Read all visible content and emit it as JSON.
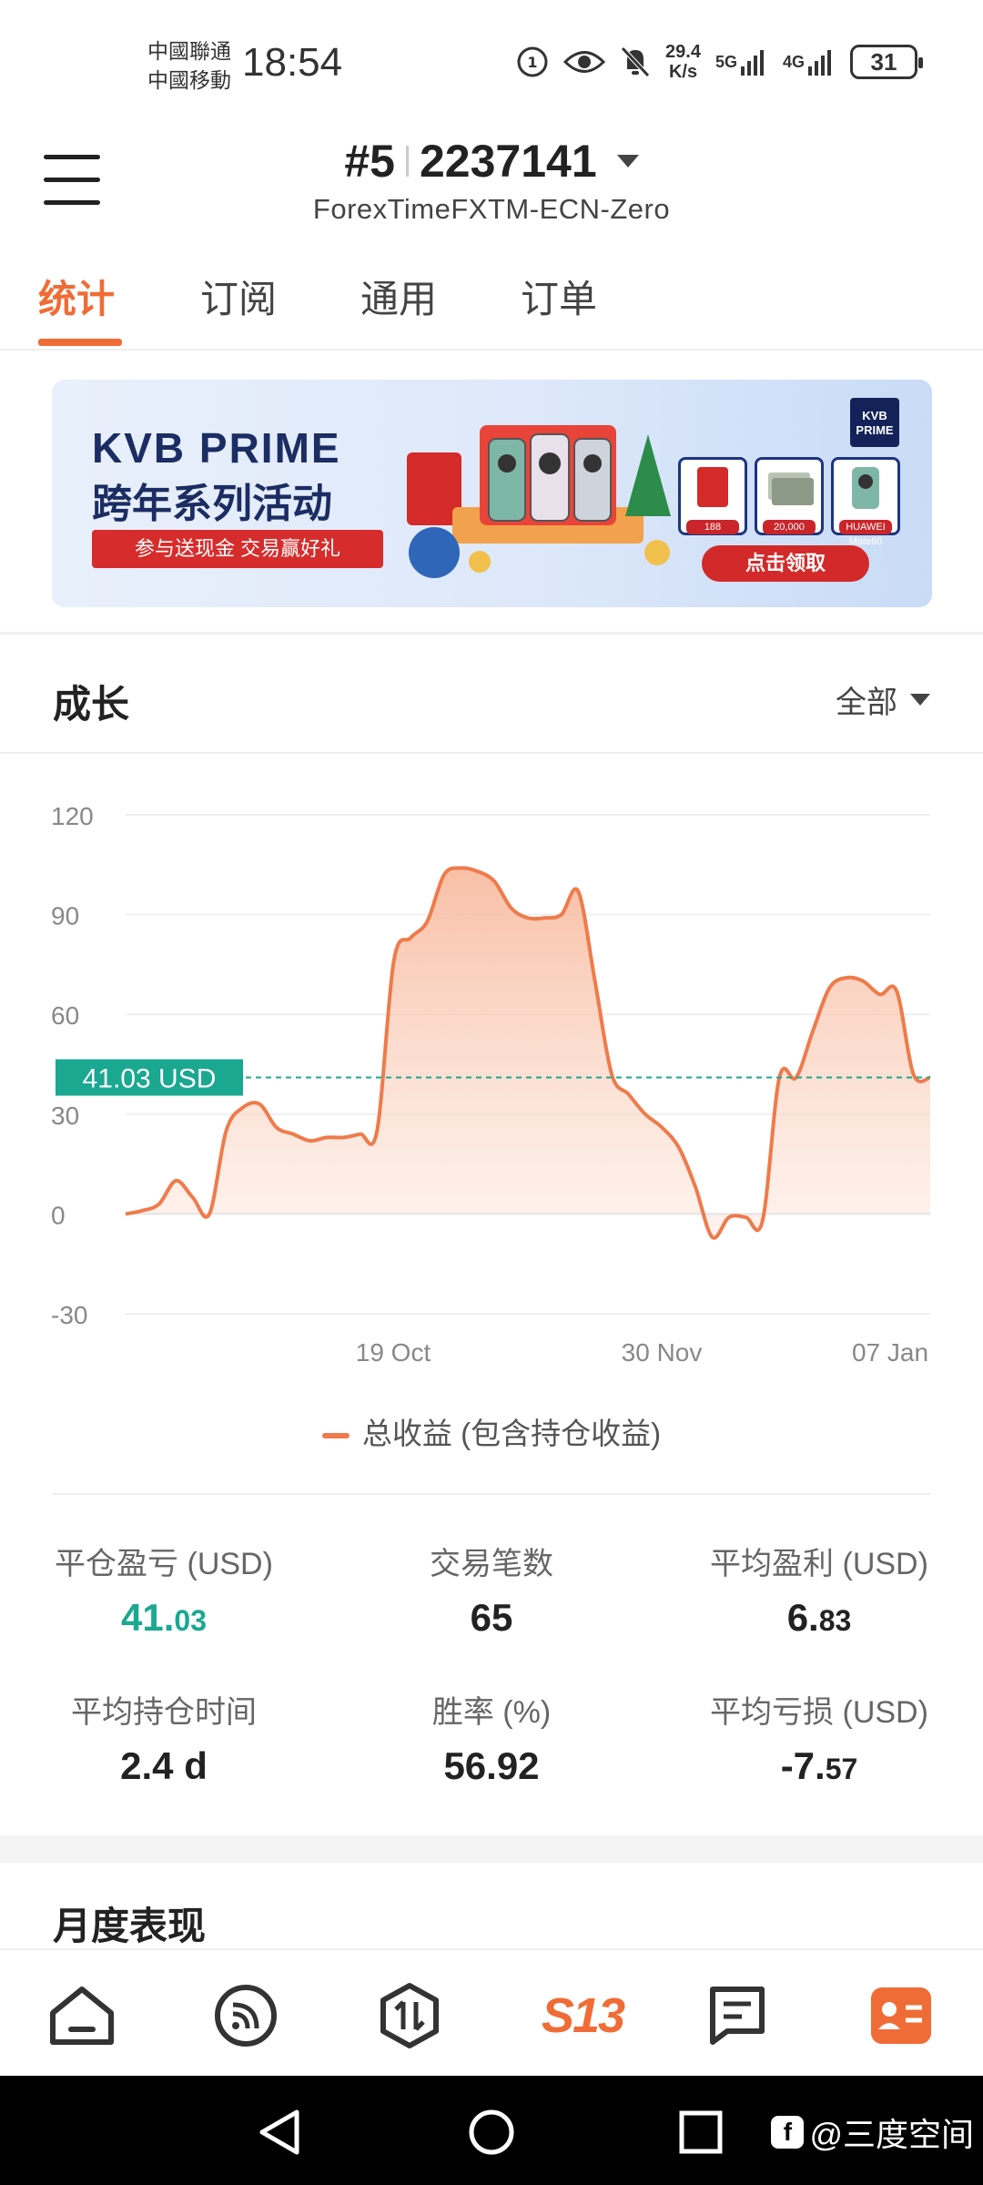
{
  "status_bar": {
    "carrier_1": "中國聯通",
    "carrier_2": "中國移動",
    "time": "18:54",
    "net_speed_value": "29.4",
    "net_speed_unit": "K/s",
    "signal_1_label": "5G",
    "signal_2_label": "4G",
    "battery": "31"
  },
  "header": {
    "account_index": "#5",
    "account_number": "2237141",
    "server": "ForexTimeFXTM-ECN-Zero"
  },
  "tabs": [
    {
      "label": "统计",
      "active": true
    },
    {
      "label": "订阅",
      "active": false
    },
    {
      "label": "通用",
      "active": false
    },
    {
      "label": "订单",
      "active": false
    }
  ],
  "banner": {
    "title_1": "KVB PRIME",
    "title_2": "跨年系列活动",
    "ribbon": "参与送现金 交易赢好礼",
    "logo": "KVB PRIME",
    "prize_1": "188",
    "prize_2": "20,000",
    "prize_3": "HUAWEI Mate60",
    "cta": "点击领取"
  },
  "growth": {
    "title": "成长",
    "range": "全部",
    "current_label": "41.03 USD",
    "legend": "总收益 (包含持仓收益)"
  },
  "chart_data": {
    "type": "area",
    "title": "",
    "xlabel": "",
    "ylabel": "",
    "ylim": [
      -30,
      120
    ],
    "yticks": [
      120,
      90,
      60,
      30,
      0,
      -30
    ],
    "xtick_labels": [
      "19 Oct",
      "30 Nov",
      "07 Jan"
    ],
    "current_value": 41.03,
    "grid": true,
    "legend_position": "bottom",
    "line_color": "#ef7a4a",
    "fill_color": "#fbd5c3",
    "reference_line_color": "#1aa890",
    "series": [
      {
        "name": "总收益 (包含持仓收益)",
        "values": [
          0,
          1,
          3,
          10,
          5,
          0,
          25,
          32,
          33,
          26,
          24,
          22,
          23,
          23,
          24,
          25,
          76,
          83,
          88,
          102,
          104,
          103,
          100,
          92,
          89,
          89,
          90,
          97,
          70,
          42,
          36,
          30,
          26,
          20,
          8,
          -7,
          -1,
          -1,
          -2,
          41,
          41,
          55,
          68,
          71,
          70,
          66,
          67,
          42,
          41
        ]
      }
    ]
  },
  "stats": [
    {
      "label": "平仓盈亏 (USD)",
      "main": "41.",
      "dec": "03",
      "teal": true
    },
    {
      "label": "交易笔数",
      "main": "65",
      "dec": "",
      "teal": false
    },
    {
      "label": "平均盈利 (USD)",
      "main": "6.",
      "dec": "83",
      "teal": false
    },
    {
      "label": "平均持仓时间",
      "main": "2.4 d",
      "dec": "",
      "teal": false
    },
    {
      "label": "胜率 (%)",
      "main": "56.92",
      "dec": "",
      "teal": false
    },
    {
      "label": "平均亏损 (USD)",
      "main": "-7.",
      "dec": "57",
      "teal": false
    }
  ],
  "monthly": {
    "title": "月度表现"
  },
  "bottom_nav": {
    "items": [
      "home-icon",
      "signal-feed-icon",
      "trade-swap-icon",
      "s13-logo",
      "message-icon",
      "account-card-icon"
    ],
    "logo_text": "S13"
  },
  "watermark": {
    "text": "@三度空间"
  }
}
